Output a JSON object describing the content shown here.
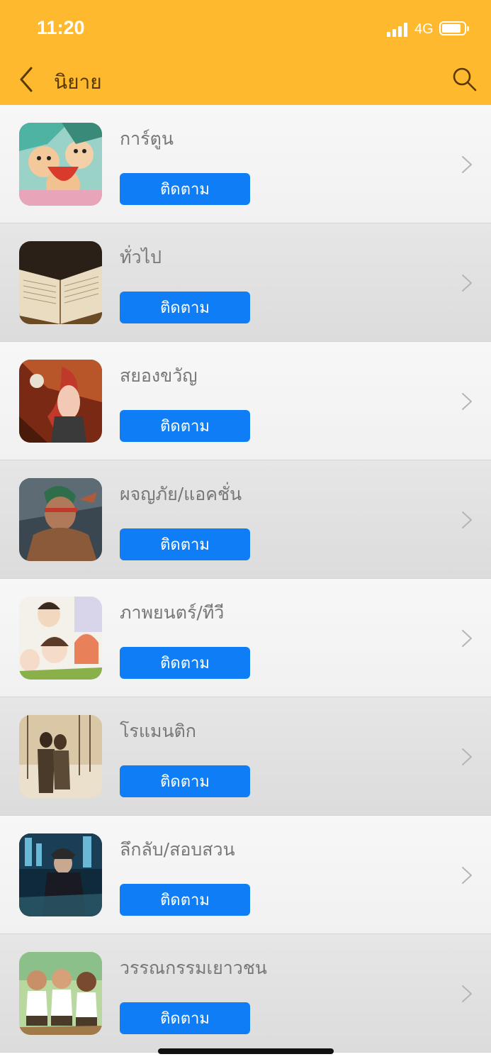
{
  "status_bar": {
    "time": "11:20",
    "network": "4G",
    "battery_level": 0.85
  },
  "header": {
    "title": "นิยาย",
    "back_icon": "chevron-left-icon",
    "search_icon": "search-icon"
  },
  "colors": {
    "header_bg": "#FFB92E",
    "button_bg": "#0F7DF6",
    "button_text": "#FFFFFF"
  },
  "categories": [
    {
      "title": "การ์ตูน",
      "button_label": "ติดตาม",
      "image": "cartoon-image"
    },
    {
      "title": "ทั่วไป",
      "button_label": "ติดตาม",
      "image": "book-image"
    },
    {
      "title": "สยองขวัญ",
      "button_label": "ติดตาม",
      "image": "horror-image"
    },
    {
      "title": "ผจญภัย/แอคชั่น",
      "button_label": "ติดตาม",
      "image": "action-image"
    },
    {
      "title": "ภาพยนตร์/ทีวี",
      "button_label": "ติดตาม",
      "image": "movie-image"
    },
    {
      "title": "โรแมนติก",
      "button_label": "ติดตาม",
      "image": "romance-image"
    },
    {
      "title": "ลึกลับ/สอบสวน",
      "button_label": "ติดตาม",
      "image": "mystery-image"
    },
    {
      "title": "วรรณกรรมเยาวชน",
      "button_label": "ติดตาม",
      "image": "youth-image"
    }
  ]
}
